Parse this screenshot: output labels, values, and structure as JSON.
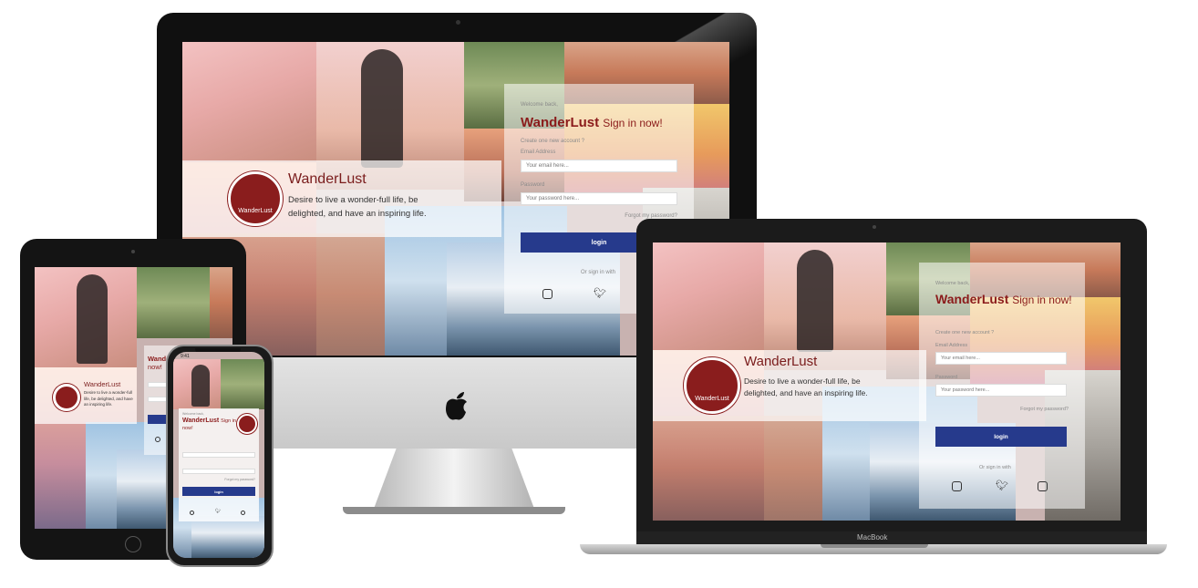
{
  "devices": {
    "imac": {
      "welcome": "Welcome back,",
      "brand": "WanderLust",
      "signin": "Sign in now!",
      "create_account": "Create one new account ?",
      "email_label": "Email Address",
      "email_placeholder": "Your email here...",
      "password_label": "Password",
      "password_placeholder": "Your password here...",
      "forgot": "Forgot my password?",
      "login": "login",
      "or_sign_in": "Or sign in with",
      "hero_title": "WanderLust",
      "hero_tagline": "Desire to live a wonder-full life, be delighted, and have an inspiring life.",
      "logo_text": "WanderLust"
    },
    "macbook": {
      "welcome": "Welcome back,",
      "brand": "WanderLust",
      "signin": "Sign in now!",
      "create_account": "Create one new account ?",
      "email_label": "Email Address",
      "email_placeholder": "Your email here...",
      "password_label": "Password",
      "password_placeholder": "Your password here...",
      "forgot": "Forgot my password?",
      "login": "login",
      "or_sign_in": "Or sign in with",
      "hero_title": "WanderLust",
      "hero_tagline": "Desire to live a wonder-full life, be delighted, and have an inspiring life.",
      "logo_text": "WanderLust",
      "label": "MacBook"
    },
    "ipad": {
      "hero_title": "WanderLust",
      "hero_tagline": "Desire to live a wonder-full life, be delighted, and have an inspiring life.",
      "brand": "Wande",
      "signin": "now!"
    },
    "iphone": {
      "time": "9:41",
      "welcome": "Welcome back,",
      "brand": "WanderLust",
      "signin": "Sign in now!",
      "login": "login",
      "forgot": "Forgot my password?"
    }
  },
  "colors": {
    "brand": "#8b1b1b",
    "button": "#263a8c",
    "logo": "#8a1d1d"
  },
  "icons": [
    "instagram-icon",
    "twitter-icon",
    "apple-logo-icon"
  ]
}
